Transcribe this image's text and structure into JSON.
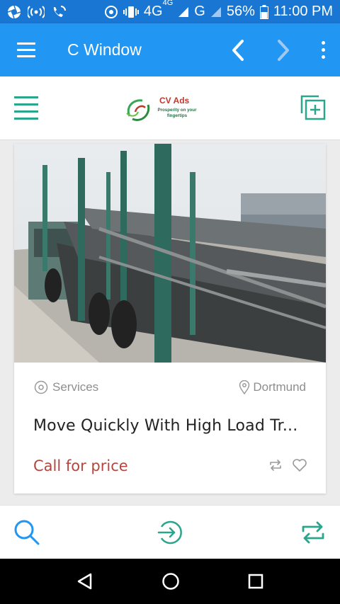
{
  "status_bar": {
    "network": "4G",
    "network_sup": "4G",
    "network2": "G",
    "battery": "56%",
    "time": "11:00 PM"
  },
  "app_bar": {
    "title": "C Window"
  },
  "logo": {
    "brand": "CV Ads",
    "tagline": "Prosperity on your fingertips"
  },
  "listing": {
    "category": "Services",
    "location": "Dortmund",
    "title": "Move Quickly With High Load Tr...",
    "price": "Call for price"
  },
  "colors": {
    "status_bar": "#1976d2",
    "app_bar": "#2196f3",
    "accent_teal": "#2ca58d",
    "price_red": "#b3473f"
  }
}
